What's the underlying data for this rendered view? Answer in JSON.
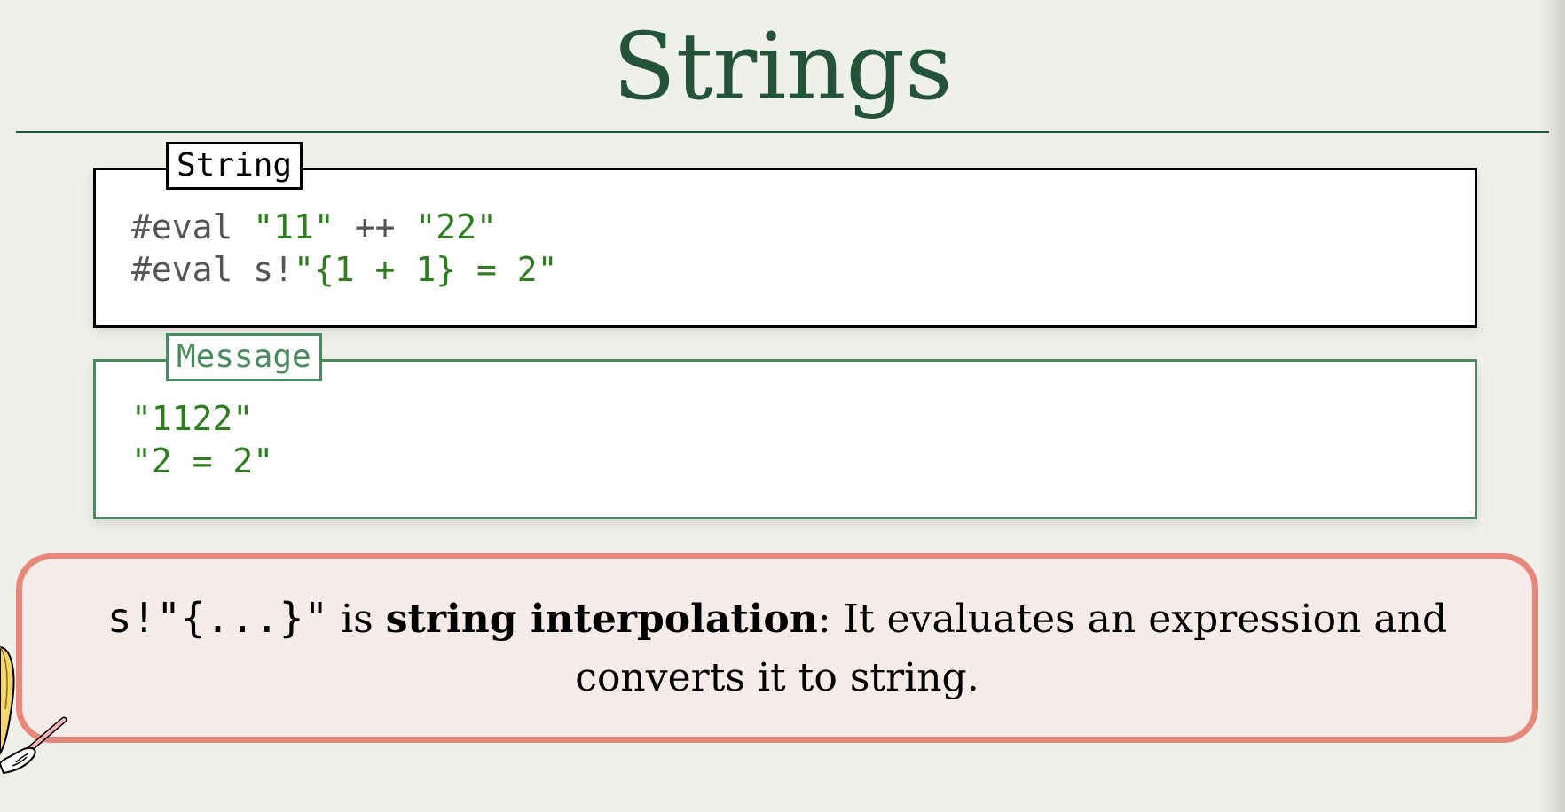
{
  "title": "Strings",
  "code_box": {
    "tab": "String",
    "lines": [
      {
        "kw": "#eval",
        "a": "\"11\"",
        "op": "++",
        "b": "\"22\""
      },
      {
        "kw": "#eval",
        "prefix": "s!",
        "interp": "\"{1 + 1} = 2\""
      }
    ]
  },
  "message_box": {
    "tab": "Message",
    "lines": [
      "\"1122\"",
      "\"2 = 2\""
    ]
  },
  "callout": {
    "code": "s!\"{...}\"",
    "pre": "is",
    "term": "string interpolation",
    "post": ": It evaluates an expression and",
    "line2": "converts it to string."
  },
  "colors": {
    "title": "#235437",
    "string": "#2e7d1f",
    "message_border": "#4a8a5e",
    "callout_border": "#e8877c",
    "callout_bg": "#f5ecea"
  }
}
